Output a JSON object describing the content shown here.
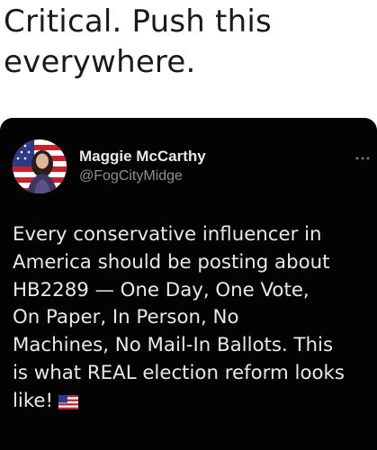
{
  "caption": {
    "line1": "Critical. Push this",
    "line2": "everywhere."
  },
  "post": {
    "author_name": "Maggie McCarthy",
    "author_handle": "@FogCityMidge",
    "more_icon": "more-horizontal-icon",
    "text_lines": [
      "Every conservative influencer in",
      "America should be posting about",
      "HB2289 — One Day, One Vote,",
      "On Paper, In Person, No",
      "Machines, No Mail-In Ballots. This",
      "is what REAL election reform looks",
      "like!"
    ],
    "emoji": "us-flag-emoji"
  },
  "colors": {
    "card_background": "#030303",
    "name_text": "#e8e8e8",
    "handle_text": "#8b8f93",
    "body_text": "#e9e9e9"
  }
}
